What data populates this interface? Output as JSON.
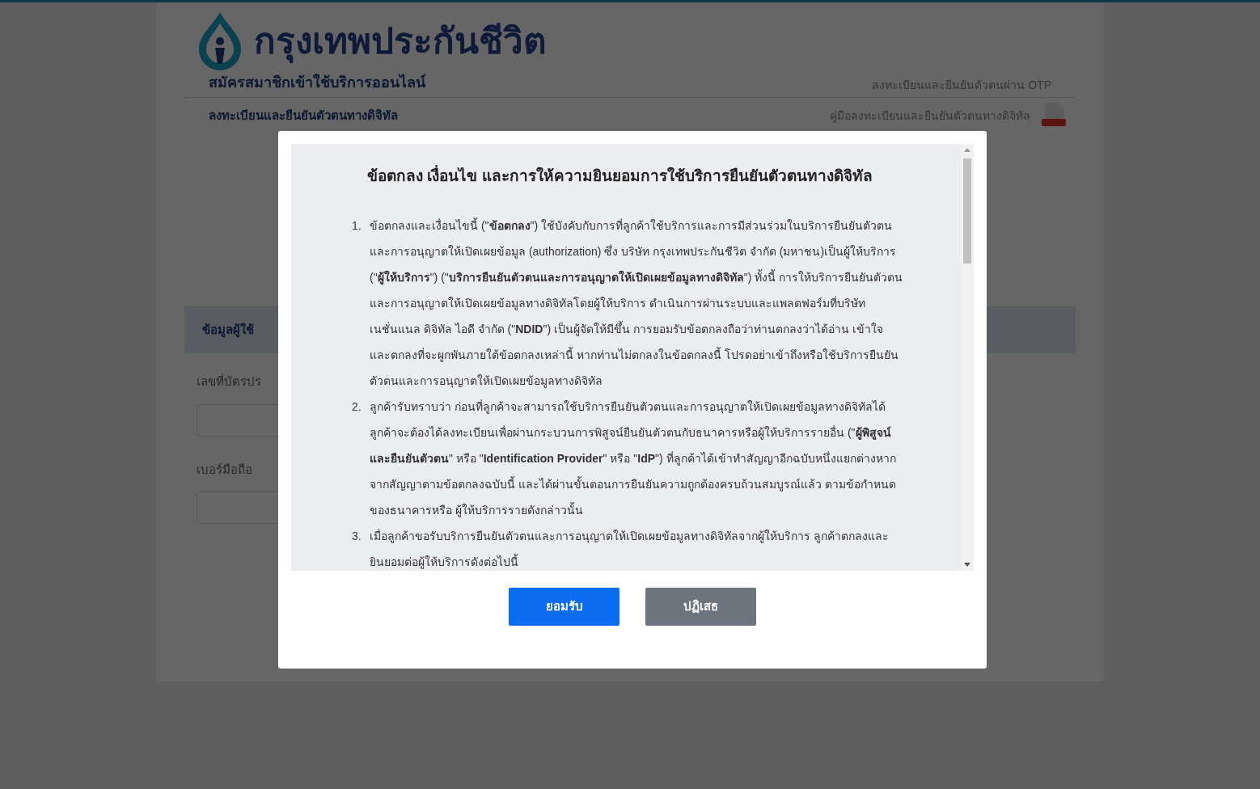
{
  "header": {
    "brand": "กรุงเทพประกันชีวิต",
    "subtitle": "สมัครสมาชิกเข้าใช้บริการออนไลน์",
    "otp_link": "ลงทะเบียนและยืนยันตัวตนผ่าน OTP"
  },
  "section_bar": {
    "title": "ลงทะเบียนและยืนยันตัวตนทางดิจิทัล",
    "manual_link": "คู่มือลงทะเบียนและยืนยันตัวตนทางดิจิทัล"
  },
  "form": {
    "title": "ข้อมูลผู้ใช้",
    "fields": [
      {
        "label": "เลขที่บัตรปร"
      },
      {
        "label": "เบอร์มือถือ"
      }
    ]
  },
  "dialog": {
    "title": "ข้อตกลง เงื่อนไข และการให้ความยินยอมการใช้บริการยืนยันตัวตนทางดิจิทัล",
    "items": [
      {
        "number": "1.",
        "text": "ข้อตกลงและเงื่อนไขนี้ (\"**ข้อตกลง**\") ใช้บังคับกับการที่ลูกค้าใช้บริการและการมีส่วนร่วมในบริการยืนยันตัวตนและการอนุญาตให้เปิดเผยข้อมูล (authorization) ซึ่ง บริษัท กรุงเทพประกันชีวิต จำกัด (มหาชน)เป็นผู้ให้บริการ (\"**ผู้ให้บริการ**\") (\"**บริการยืนยันตัวตนและการอนุญาตให้เปิดเผยข้อมูลทางดิจิทัล**\") ทั้งนี้ การให้บริการยืนยันตัวตนและการอนุญาตให้เปิดเผยข้อมูลทางดิจิทัลโดยผู้ให้บริการ ดำเนินการผ่านระบบและแพลตฟอร์มที่บริษัท เนชั่นแนล ดิจิทัล ไอดี จำกัด (\"**NDID**\") เป็นผู้จัดให้มีขึ้น การยอมรับข้อตกลงถือว่าท่านตกลงว่าได้อ่าน เข้าใจ และตกลงที่จะผูกพันภายใต้ข้อตกลงเหล่านี้ หากท่านไม่ตกลงในข้อตกลงนี้ โปรดอย่าเข้าถึงหรือใช้บริการยืนยันตัวตนและการอนุญาตให้เปิดเผยข้อมูลทางดิจิทัล"
      },
      {
        "number": "2.",
        "text": "ลูกค้ารับทราบว่า ก่อนที่ลูกค้าจะสามารถใช้บริการยืนยันตัวตนและการอนุญาตให้เปิดเผยข้อมูลทางดิจิทัลได้ ลูกค้าจะต้องได้ลงทะเบียนเพื่อผ่านกระบวนการพิสูจน์ยืนยันตัวตนกับธนาคารหรือผู้ให้บริการรายอื่น (\"**ผู้พิสูจน์และยืนยันตัวตน**\" หรือ \"**Identification Provider**\" หรือ \"**IdP**\") ที่ลูกค้าได้เข้าทำสัญญาอีกฉบับหนึ่งแยกต่างหากจากสัญญาตามข้อตกลงฉบับนี้ และได้ผ่านขั้นตอนการยืนยันความถูกต้องครบถ้วนสมบูรณ์แล้ว ตามข้อกำหนดของธนาคารหรือ ผู้ให้บริการรายดังกล่าวนั้น"
      },
      {
        "number": "3.",
        "text": "เมื่อลูกค้าขอรับบริการยืนยันตัวตนและการอนุญาตให้เปิดเผยข้อมูลทางดิจิทัลจากผู้ให้บริการ ลูกค้าตกลงและยินยอมต่อผู้ให้บริการดังต่อไปนี้"
      }
    ],
    "buttons": [
      {
        "kind": "primary",
        "label": "ยอมรับ"
      },
      {
        "kind": "secondary",
        "label": "ปฏิเสธ"
      }
    ]
  }
}
